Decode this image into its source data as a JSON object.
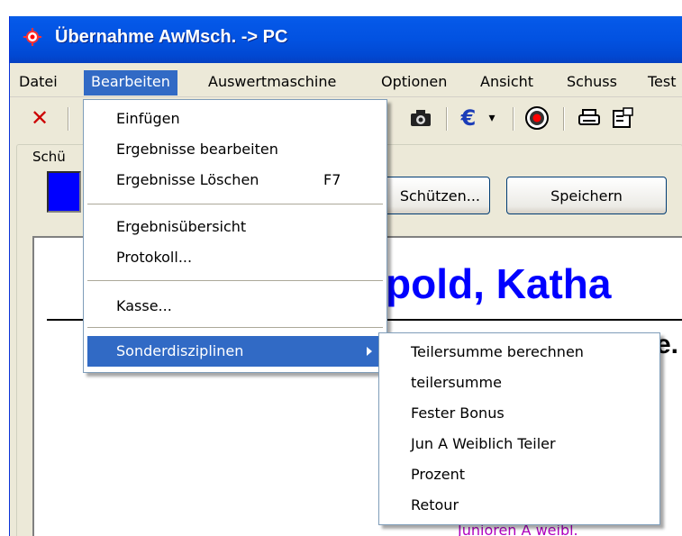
{
  "window": {
    "title": "Übernahme AwMsch. -> PC"
  },
  "menubar": {
    "items": [
      "Datei",
      "Bearbeiten",
      "Auswertmaschine",
      "Optionen",
      "Ansicht",
      "Schuss",
      "Test"
    ]
  },
  "toolbar": {
    "icons": [
      "close-icon",
      "camera-icon",
      "euro-icon",
      "dropdown-arrow-icon",
      "target-icon",
      "printer-icon",
      "properties-icon"
    ]
  },
  "group": {
    "label": "Schü"
  },
  "buttons": {
    "shooters": "Schützen...",
    "save": "Speichern"
  },
  "content": {
    "name_partial": "pold, Katha",
    "partial_text": "e.",
    "bottom_partial": "Junioren A weibl."
  },
  "edit_menu": {
    "items": [
      {
        "label": "Einfügen",
        "shortcut": ""
      },
      {
        "label": "Ergebnisse bearbeiten",
        "shortcut": ""
      },
      {
        "label": "Ergebnisse Löschen",
        "shortcut": "F7"
      },
      {
        "label": "Ergebnisübersicht",
        "shortcut": ""
      },
      {
        "label": "Protokoll...",
        "shortcut": ""
      },
      {
        "label": "Kasse...",
        "shortcut": ""
      },
      {
        "label": "Sonderdisziplinen",
        "shortcut": ""
      }
    ]
  },
  "submenu": {
    "items": [
      "Teilersumme berechnen",
      "teilersumme",
      "Fester Bonus",
      "Jun A Weiblich Teiler",
      "Prozent",
      "Retour"
    ]
  },
  "colors": {
    "titlebar": "#0252e1",
    "highlight": "#316ac5",
    "name_text": "#0000ff",
    "bottom_text": "#b000c0"
  }
}
